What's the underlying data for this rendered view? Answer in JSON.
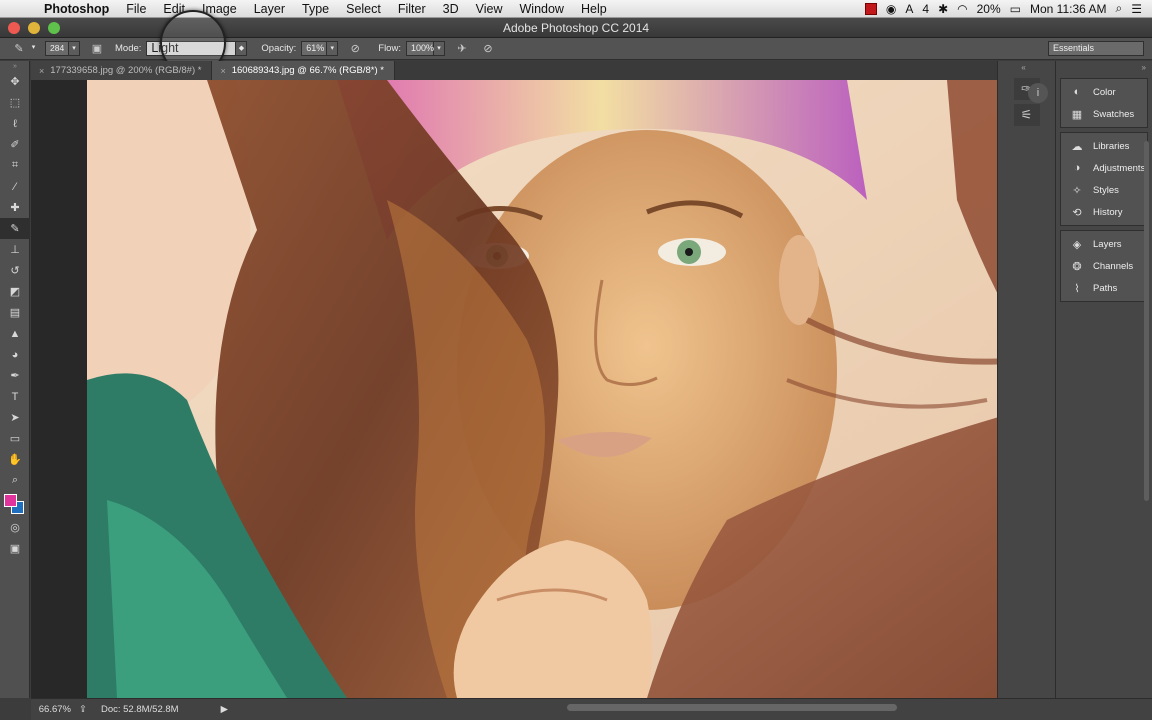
{
  "menubar": {
    "items": [
      "Photoshop",
      "File",
      "Edit",
      "Image",
      "Layer",
      "Type",
      "Select",
      "Filter",
      "3D",
      "View",
      "Window",
      "Help"
    ],
    "status": {
      "adobe_icon": "adobe-icon",
      "extra": "4",
      "battery": "20%",
      "clock": "Mon 11:36 AM"
    }
  },
  "window": {
    "title": "Adobe Photoshop CC 2014"
  },
  "options": {
    "brush_size": "284",
    "mode_label": "Mode:",
    "mode_value": "Light",
    "opacity_label": "Opacity:",
    "opacity_value": "61%",
    "flow_label": "Flow:",
    "flow_value": "100%",
    "workspace": "Essentials"
  },
  "tabs": [
    {
      "label": "177339658.jpg @ 200% (RGB/8#) *",
      "active": false
    },
    {
      "label": "160689343.jpg @ 66.7% (RGB/8*) *",
      "active": true
    }
  ],
  "toolbar": {
    "foreground_color": "#e0339b",
    "background_color": "#1f6fbf"
  },
  "panels": [
    {
      "group": [
        {
          "label": "Color",
          "icon": "color-wheel-icon"
        },
        {
          "label": "Swatches",
          "icon": "swatches-grid-icon"
        }
      ]
    },
    {
      "group": [
        {
          "label": "Libraries",
          "icon": "libraries-cloud-icon"
        },
        {
          "label": "Adjustments",
          "icon": "adjustments-icon"
        },
        {
          "label": "Styles",
          "icon": "styles-icon"
        },
        {
          "label": "History",
          "icon": "history-icon"
        }
      ]
    },
    {
      "group": [
        {
          "label": "Layers",
          "icon": "layers-icon"
        },
        {
          "label": "Channels",
          "icon": "channels-icon"
        },
        {
          "label": "Paths",
          "icon": "paths-icon"
        }
      ]
    }
  ],
  "statusbar": {
    "zoom": "66.67%",
    "doc": "Doc: 52.8M/52.8M"
  }
}
